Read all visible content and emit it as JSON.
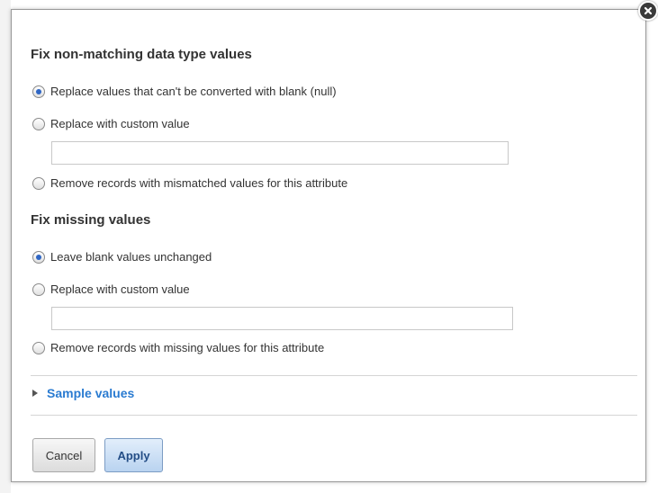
{
  "close_icon": "close-icon",
  "section_type": {
    "heading": "Fix non-matching data type values",
    "options": [
      {
        "label": "Replace values that can't be converted with blank (null)",
        "checked": true
      },
      {
        "label": "Replace with custom value",
        "checked": false
      },
      {
        "label": "Remove records with mismatched values for this attribute",
        "checked": false
      }
    ],
    "custom_value": ""
  },
  "section_missing": {
    "heading": "Fix missing values",
    "options": [
      {
        "label": "Leave blank values unchanged",
        "checked": true
      },
      {
        "label": "Replace with custom value",
        "checked": false
      },
      {
        "label": "Remove records with missing values for this attribute",
        "checked": false
      }
    ],
    "custom_value": ""
  },
  "sample_values": {
    "label": "Sample values",
    "icon": "disclosure-triangle-icon",
    "expanded": false
  },
  "buttons": {
    "cancel": "Cancel",
    "apply": "Apply"
  },
  "colors": {
    "link": "#2a7bd1",
    "radio_selected": "#2f66c4",
    "apply_bg": "#b9d3f0"
  }
}
